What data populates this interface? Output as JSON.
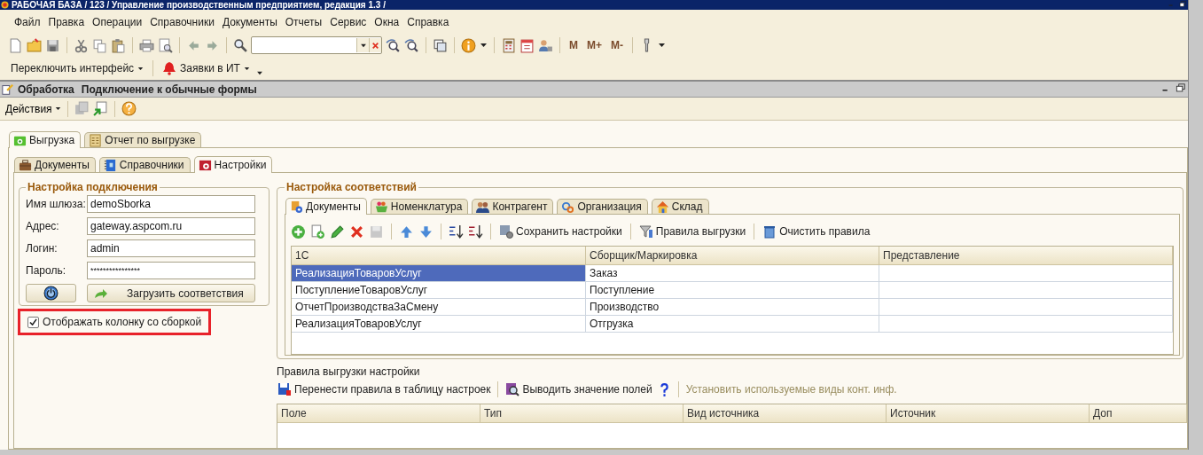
{
  "window": {
    "title": "РАБОЧАЯ БАЗА / 123 / Управление производственным предприятием, редакция 1.3 /"
  },
  "menu": [
    "Файл",
    "Правка",
    "Операции",
    "Справочники",
    "Документы",
    "Отчеты",
    "Сервис",
    "Окна",
    "Справка"
  ],
  "toolbar": {
    "memory_buttons": [
      "M",
      "M+",
      "M-"
    ]
  },
  "quick_bar": [
    {
      "label": "Переключить интерфейс",
      "kind": "menu"
    },
    {
      "label": "Заявки в ИТ",
      "kind": "alert"
    }
  ],
  "form": {
    "type": "Обработка",
    "title": "Подключение к обычные формы",
    "actions": "Действия"
  },
  "tabs": [
    {
      "label": "Выгрузка",
      "selected": true,
      "kind": "export"
    },
    {
      "label": "Отчет по выгрузке",
      "selected": false,
      "kind": "report"
    }
  ],
  "subtabs": [
    {
      "label": "Документы",
      "selected": false,
      "kind": "briefcase"
    },
    {
      "label": "Справочники",
      "selected": false,
      "kind": "book"
    },
    {
      "label": "Настройки",
      "selected": true,
      "kind": "settings"
    }
  ],
  "connection": {
    "legend": "Настройка подключения",
    "fields": [
      {
        "label": "Имя шлюза:",
        "value": "demoSborka",
        "kind": "text"
      },
      {
        "label": "Адрес:",
        "value": "gateway.aspcom.ru",
        "kind": "text"
      },
      {
        "label": "Логин:",
        "value": "admin",
        "kind": "text"
      },
      {
        "label": "Пароль:",
        "value": "****************",
        "kind": "password"
      }
    ],
    "load_button": "Загрузить соответствия"
  },
  "show_column": {
    "label": "Отображать колонку со сборкой",
    "checked": true,
    "highlighted": true
  },
  "mapping": {
    "legend": "Настройка соответствий",
    "tabs": [
      {
        "label": "Документы",
        "selected": true,
        "kind": "documents"
      },
      {
        "label": "Номенклатура",
        "selected": false,
        "kind": "basket"
      },
      {
        "label": "Контрагент",
        "selected": false,
        "kind": "people"
      },
      {
        "label": "Организация",
        "selected": false,
        "kind": "org"
      },
      {
        "label": "Склад",
        "selected": false,
        "kind": "house"
      }
    ],
    "toolbar": [
      {
        "kind": "add",
        "disabled": false
      },
      {
        "kind": "copy",
        "disabled": false
      },
      {
        "kind": "edit",
        "disabled": false
      },
      {
        "kind": "delete",
        "disabled": false
      },
      {
        "kind": "save",
        "disabled": true
      },
      {
        "kind": "up",
        "disabled": false
      },
      {
        "kind": "down",
        "disabled": false
      },
      {
        "kind": "sort-asc",
        "disabled": false
      },
      {
        "kind": "sort-desc",
        "disabled": false
      },
      {
        "kind": "save-settings",
        "label": "Сохранить настройки",
        "disabled": false
      },
      {
        "kind": "rules",
        "label": "Правила выгрузки",
        "disabled": false
      },
      {
        "kind": "clear",
        "label": "Очистить правила",
        "disabled": false
      }
    ],
    "columns": [
      "1С",
      "Сборщик/Маркировка",
      "Представление"
    ],
    "rows": [
      {
        "cells": [
          "РеализацияТоваровУслуг",
          "Заказ"
        ],
        "selected": true
      },
      {
        "cells": [
          "ПоступлениеТоваровУслуг",
          "Поступление"
        ],
        "selected": false
      },
      {
        "cells": [
          "ОтчетПроизводстваЗаСмену",
          "Производство"
        ],
        "selected": false
      },
      {
        "cells": [
          "РеализацияТоваровУслуг",
          "Отгрузка"
        ],
        "selected": false
      }
    ]
  },
  "rules": {
    "label": "Правила выгрузки настройки",
    "toolbar": [
      {
        "kind": "transfer",
        "label": "Перенести правила в таблицу настроек",
        "disabled": false
      },
      {
        "kind": "inspect",
        "label": "Выводить значение полей",
        "disabled": false
      },
      {
        "kind": "help",
        "disabled": false
      },
      {
        "kind": "link",
        "label": "Установить используемые виды конт. инф.",
        "disabled": true
      }
    ],
    "columns": [
      "Поле",
      "Тип",
      "Вид источника",
      "Источник",
      "Доп"
    ]
  }
}
